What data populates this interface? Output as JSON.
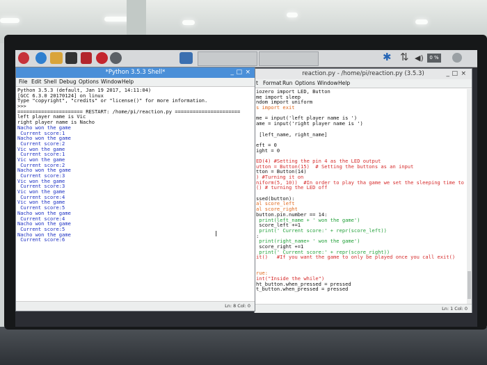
{
  "taskbar": {
    "icons": [
      "raspberry-menu-icon",
      "web-browser-icon",
      "file-manager-icon",
      "terminal-icon",
      "mathematica-icon",
      "wolfram-icon",
      "wolfram-alpha-icon",
      "python-idle-icon"
    ],
    "tray": {
      "bluetooth": "✱",
      "network": "⇅",
      "volume": "◀)",
      "cpu": "0 %"
    }
  },
  "shell": {
    "title": "*Python 3.5.3 Shell*",
    "controls": [
      "_",
      "□",
      "×"
    ],
    "menu": [
      "File",
      "Edit",
      "Shell",
      "Debug",
      "Options",
      "Window",
      "Help"
    ],
    "lines": [
      {
        "t": "Python 3.5.3 (default, Jan 19 2017, 14:11:04)",
        "c": "out"
      },
      {
        "t": "[GCC 6.3.0 20170124] on linux",
        "c": "out"
      },
      {
        "t": "Type \"copyright\", \"credits\" or \"license()\" for more information.",
        "c": "out"
      },
      {
        "t": ">>>",
        "c": "out"
      },
      {
        "t": "====================== RESTART: /home/pi/reaction.py ======================",
        "c": "out"
      },
      {
        "t": "left player name is Vic",
        "c": "out"
      },
      {
        "t": "right player name is Nacho",
        "c": "out"
      },
      {
        "t": "Nacho won the game",
        "c": "blue"
      },
      {
        "t": " Current score:1",
        "c": "blue"
      },
      {
        "t": "Nacho won the game",
        "c": "blue"
      },
      {
        "t": " Current score:2",
        "c": "blue"
      },
      {
        "t": "Vic won the game",
        "c": "blue"
      },
      {
        "t": " Current score:1",
        "c": "blue"
      },
      {
        "t": "Vic won the game",
        "c": "blue"
      },
      {
        "t": " Current score:2",
        "c": "blue"
      },
      {
        "t": "Nacho won the game",
        "c": "blue"
      },
      {
        "t": " Current score:3",
        "c": "blue"
      },
      {
        "t": "Vic won the game",
        "c": "blue"
      },
      {
        "t": " Current score:3",
        "c": "blue"
      },
      {
        "t": "Vic won the game",
        "c": "blue"
      },
      {
        "t": " Current score:4",
        "c": "blue"
      },
      {
        "t": "Vic won the game",
        "c": "blue"
      },
      {
        "t": " Current score:5",
        "c": "blue"
      },
      {
        "t": "Nacho won the game",
        "c": "blue"
      },
      {
        "t": " Current score:4",
        "c": "blue"
      },
      {
        "t": "Nacho won the game",
        "c": "blue"
      },
      {
        "t": " Current score:5",
        "c": "blue"
      },
      {
        "t": "Nacho won the game",
        "c": "blue"
      },
      {
        "t": " Current score:6",
        "c": "blue"
      }
    ],
    "status": "Ln: 8  Col: 0"
  },
  "editor": {
    "title": "reaction.py - /home/pi/reaction.py (3.5.3)",
    "controls": [
      "_",
      "□",
      "×"
    ],
    "menu": [
      "t",
      "Format",
      "Run",
      "Options",
      "Window",
      "Help"
    ],
    "lines": [
      {
        "t": "iozero import LED, Button",
        "c": "def"
      },
      {
        "t": "me import sleep",
        "c": "def"
      },
      {
        "t": "ndom import uniform",
        "c": "def"
      },
      {
        "t": "s import exit",
        "c": "kw"
      },
      {
        "t": "",
        "c": "def"
      },
      {
        "t": "me = input('left player name is ')",
        "c": "def"
      },
      {
        "t": "ame = input('right player name is ')",
        "c": "def"
      },
      {
        "t": "",
        "c": "def"
      },
      {
        "t": " [left_name, right_name]",
        "c": "def"
      },
      {
        "t": "",
        "c": "def"
      },
      {
        "t": "eft = 0",
        "c": "def"
      },
      {
        "t": "ight = 0",
        "c": "def"
      },
      {
        "t": "",
        "c": "def"
      },
      {
        "t": "ED(4) #Setting the pin 4 as the LED output",
        "c": "com"
      },
      {
        "t": "utton = Button(15)  # Setting the buttons as an input",
        "c": "com"
      },
      {
        "t": "tton = Button(14)",
        "c": "def"
      },
      {
        "t": ") #Turning it on",
        "c": "com"
      },
      {
        "t": "niform(5, 10))  #In order to play tha game we set the sleeping time to be",
        "c": "com"
      },
      {
        "t": "() # turning the LED off",
        "c": "com"
      },
      {
        "t": "",
        "c": "def"
      },
      {
        "t": "ssed(button):",
        "c": "def"
      },
      {
        "t": "al score_left",
        "c": "kw"
      },
      {
        "t": "al score_right",
        "c": "kw"
      },
      {
        "t": "button.pin.number == 14:",
        "c": "def"
      },
      {
        "t": " print(left_name + ' won the game')",
        "c": "str"
      },
      {
        "t": " score_left +=1",
        "c": "def"
      },
      {
        "t": " print(' Current score:' + repr(score_left))",
        "c": "str"
      },
      {
        "t": ":",
        "c": "def"
      },
      {
        "t": " print(right_name+ ' won the game')",
        "c": "str"
      },
      {
        "t": " score_right +=1",
        "c": "def"
      },
      {
        "t": " print(' Current score:' + repr(score_right))",
        "c": "str"
      },
      {
        "t": "it()   #If you want the game to only be played once you call exit()",
        "c": "com"
      },
      {
        "t": "",
        "c": "def"
      },
      {
        "t": "",
        "c": "def"
      },
      {
        "t": "rue:",
        "c": "kw"
      },
      {
        "t": "int(\"Inside the while\")",
        "c": "com"
      },
      {
        "t": "ht_button.when_pressed = pressed",
        "c": "def"
      },
      {
        "t": "t_button.when_pressed = pressed",
        "c": "def"
      }
    ],
    "status": "Ln: 1  Col: 0"
  }
}
